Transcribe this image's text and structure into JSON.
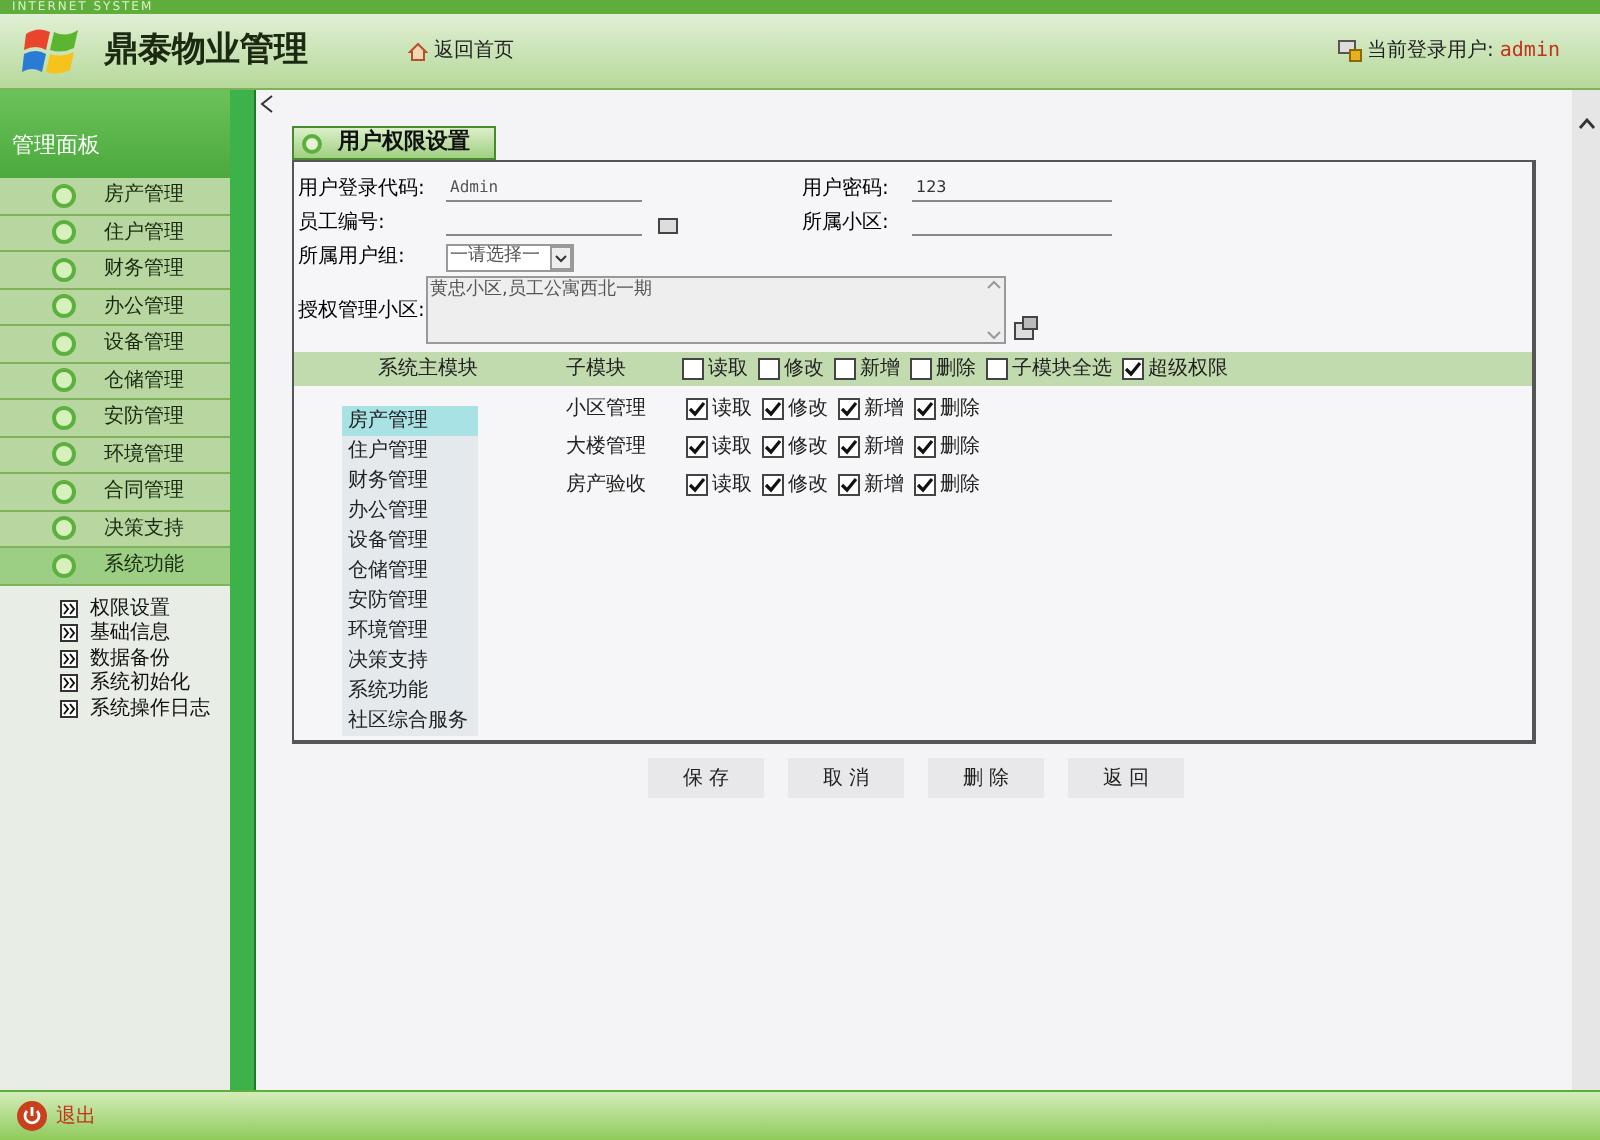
{
  "header": {
    "system_tag": "INTERNET SYSTEM",
    "title": "鼎泰物业管理",
    "home_link": "返回首页",
    "user_label": "当前登录用户:",
    "user_name": "admin"
  },
  "sidebar": {
    "title": "管理面板",
    "items": [
      {
        "label": "房产管理",
        "expanded": false
      },
      {
        "label": "住户管理",
        "expanded": false
      },
      {
        "label": "财务管理",
        "expanded": false
      },
      {
        "label": "办公管理",
        "expanded": false
      },
      {
        "label": "设备管理",
        "expanded": false
      },
      {
        "label": "仓储管理",
        "expanded": false
      },
      {
        "label": "安防管理",
        "expanded": false
      },
      {
        "label": "环境管理",
        "expanded": false
      },
      {
        "label": "合同管理",
        "expanded": false
      },
      {
        "label": "决策支持",
        "expanded": false
      },
      {
        "label": "系统功能",
        "expanded": true,
        "children": [
          {
            "label": "权限设置"
          },
          {
            "label": "基础信息"
          },
          {
            "label": "数据备份"
          },
          {
            "label": "系统初始化"
          },
          {
            "label": "系统操作日志"
          }
        ]
      }
    ]
  },
  "panel": {
    "tab": "用户权限设置",
    "login_code": {
      "label": "用户登录代码:",
      "value": "Admin"
    },
    "password": {
      "label": "用户密码:",
      "value": "123"
    },
    "employee_no": {
      "label": "员工编号:"
    },
    "community": {
      "label": "所属小区:"
    },
    "group": {
      "label": "所属用户组:",
      "value": "一请选择一"
    },
    "authorized": {
      "label": "授权管理小区:",
      "value": "黄忠小区,员工公寓西北一期"
    },
    "permissions": {
      "module_header": "系统主模块",
      "submodule_header": "子模块",
      "header_options": [
        {
          "label": "读取",
          "checked": false
        },
        {
          "label": "修改",
          "checked": false
        },
        {
          "label": "新增",
          "checked": false
        },
        {
          "label": "删除",
          "checked": false
        },
        {
          "label": "子模块全选",
          "checked": false
        },
        {
          "label": "超级权限",
          "checked": true
        }
      ],
      "modules": [
        {
          "label": "房产管理",
          "selected": true
        },
        {
          "label": "住户管理",
          "selected": false
        },
        {
          "label": "财务管理",
          "selected": false
        },
        {
          "label": "办公管理",
          "selected": false
        },
        {
          "label": "设备管理",
          "selected": false
        },
        {
          "label": "仓储管理",
          "selected": false
        },
        {
          "label": "安防管理",
          "selected": false
        },
        {
          "label": "环境管理",
          "selected": false
        },
        {
          "label": "决策支持",
          "selected": false
        },
        {
          "label": "系统功能",
          "selected": false
        },
        {
          "label": "社区综合服务",
          "selected": false
        }
      ],
      "submodules": [
        {
          "label": "小区管理",
          "options": [
            {
              "label": "读取",
              "checked": true
            },
            {
              "label": "修改",
              "checked": true
            },
            {
              "label": "新增",
              "checked": true
            },
            {
              "label": "删除",
              "checked": true
            }
          ]
        },
        {
          "label": "大楼管理",
          "options": [
            {
              "label": "读取",
              "checked": true
            },
            {
              "label": "修改",
              "checked": true
            },
            {
              "label": "新增",
              "checked": true
            },
            {
              "label": "删除",
              "checked": true
            }
          ]
        },
        {
          "label": "房产验收",
          "options": [
            {
              "label": "读取",
              "checked": true
            },
            {
              "label": "修改",
              "checked": true
            },
            {
              "label": "新增",
              "checked": true
            },
            {
              "label": "删除",
              "checked": true
            }
          ]
        }
      ]
    }
  },
  "buttons": [
    "保 存",
    "取 消",
    "删 除",
    "返 回"
  ],
  "footer": {
    "logout": "退出"
  }
}
